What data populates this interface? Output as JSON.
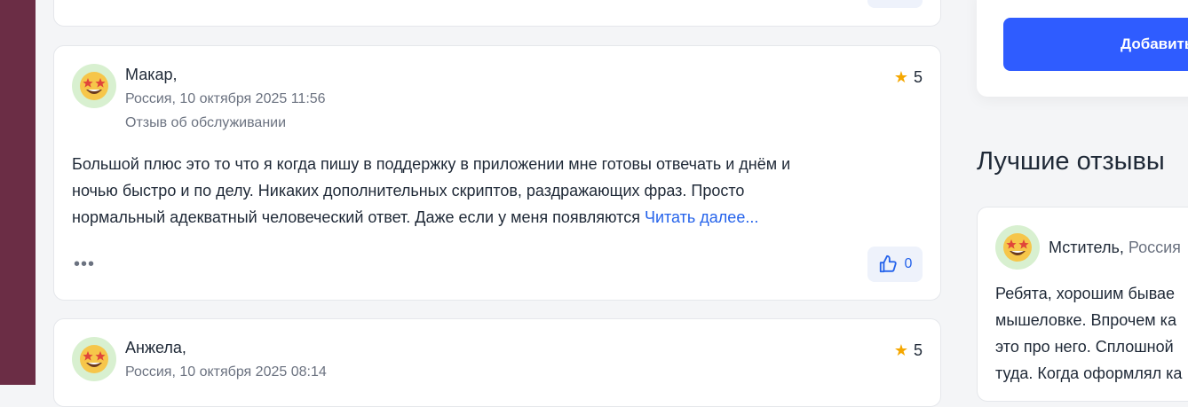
{
  "sidebar_widget": {
    "add_button_label": "Добавить"
  },
  "best_reviews": {
    "title": "Лучшие отзывы",
    "review": {
      "author": "Мститель",
      "region": "Россия",
      "text_lines": [
        "Ребята, хорошим бывае",
        "мышеловке. Впрочем ка",
        "это про него. Сплошной",
        "туда. Когда оформлял ка"
      ]
    }
  },
  "reviews": [
    {
      "author": "Макар,",
      "location_date": "Россия, 10 октября 2025 11:56",
      "category": "Отзыв об обслуживании",
      "rating": "5",
      "text_lines": [
        "Большой плюс это то что я когда пишу в поддержку в приложении мне готовы отвечать и днём и",
        "ночью быстро и по делу. Никаких дополнительных скриптов, раздражающих фраз. Просто",
        "нормальный адекватный человеческий ответ. Даже если у меня появляются "
      ],
      "read_more": "Читать далее...",
      "more_menu": "•••",
      "likes": "0"
    },
    {
      "author": "Анжела,",
      "location_date": "Россия, 10 октября 2025 08:14",
      "rating": "5"
    }
  ],
  "colors": {
    "accent": "#2563eb",
    "button": "#2f5cff",
    "star": "#f5a700",
    "left_band": "#6b2d45"
  }
}
